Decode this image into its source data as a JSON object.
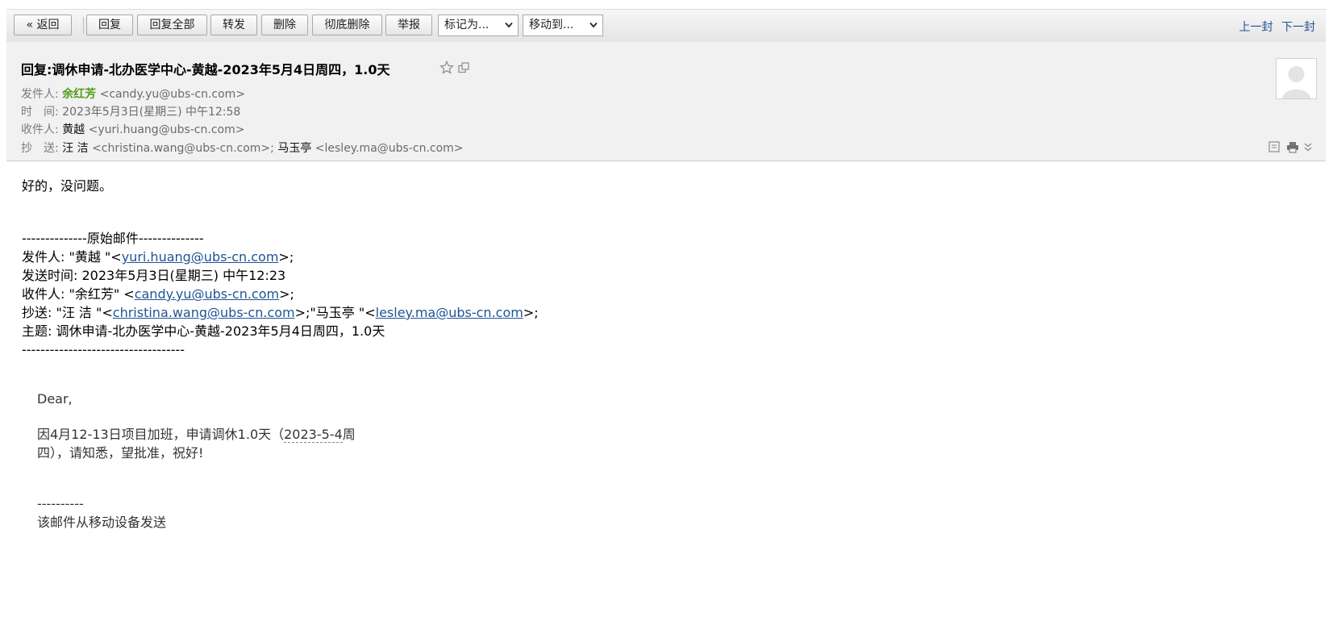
{
  "toolbar": {
    "back_label": "« 返回",
    "reply_label": "回复",
    "reply_all_label": "回复全部",
    "forward_label": "转发",
    "delete_label": "删除",
    "perm_delete_label": "彻底删除",
    "report_label": "举报",
    "mark_as_label": "标记为...",
    "move_to_label": "移动到...",
    "prev_label": "上一封",
    "next_label": "下一封"
  },
  "header": {
    "subject": "回复:调休申请-北办医学中心-黄越-2023年5月4日周四，1.0天",
    "from_label": "发件人:",
    "from_name": "余红芳",
    "from_email": "<candy.yu@ubs-cn.com>",
    "time_label": "时　间:",
    "time_value": "2023年5月3日(星期三) 中午12:58",
    "to_label": "收件人:",
    "to_name": "黄越",
    "to_email": "<yuri.huang@ubs-cn.com>",
    "cc_label": "抄　送:",
    "cc_name1": "汪 洁",
    "cc_email1": "<christina.wang@ubs-cn.com>;",
    "cc_name2": "马玉亭",
    "cc_email2": "<lesley.ma@ubs-cn.com>"
  },
  "body": {
    "reply_text": "好的，没问题。",
    "orig_divider": "--------------原始邮件--------------",
    "orig_from_prefix": "发件人: \"黄越 \"<",
    "orig_from_email": "yuri.huang@ubs-cn.com",
    "orig_from_suffix": ">;",
    "orig_time": "发送时间: 2023年5月3日(星期三) 中午12:23",
    "orig_to_prefix": "收件人: \"余红芳\" <",
    "orig_to_email": "candy.yu@ubs-cn.com",
    "orig_to_suffix": ">;",
    "orig_cc_prefix": "抄送: \"汪 洁 \"<",
    "orig_cc_email1": "christina.wang@ubs-cn.com",
    "orig_cc_mid": ">;\"马玉亭 \"<",
    "orig_cc_email2": "lesley.ma@ubs-cn.com",
    "orig_cc_suffix": ">;",
    "orig_subject": "主题: 调休申请-北办医学中心-黄越-2023年5月4日周四，1.0天",
    "orig_end_divider": "-----------------------------------"
  },
  "quote": {
    "greeting": "Dear,",
    "line1_a": "因4月12-13日项目加班，申请调休1.0天（",
    "line1_date": "2023-5-4",
    "line1_b": "周",
    "line2": "四），请知悉，望批准，祝好!",
    "sig_divider": "----------",
    "sig_text": "该邮件从移动设备发送"
  }
}
